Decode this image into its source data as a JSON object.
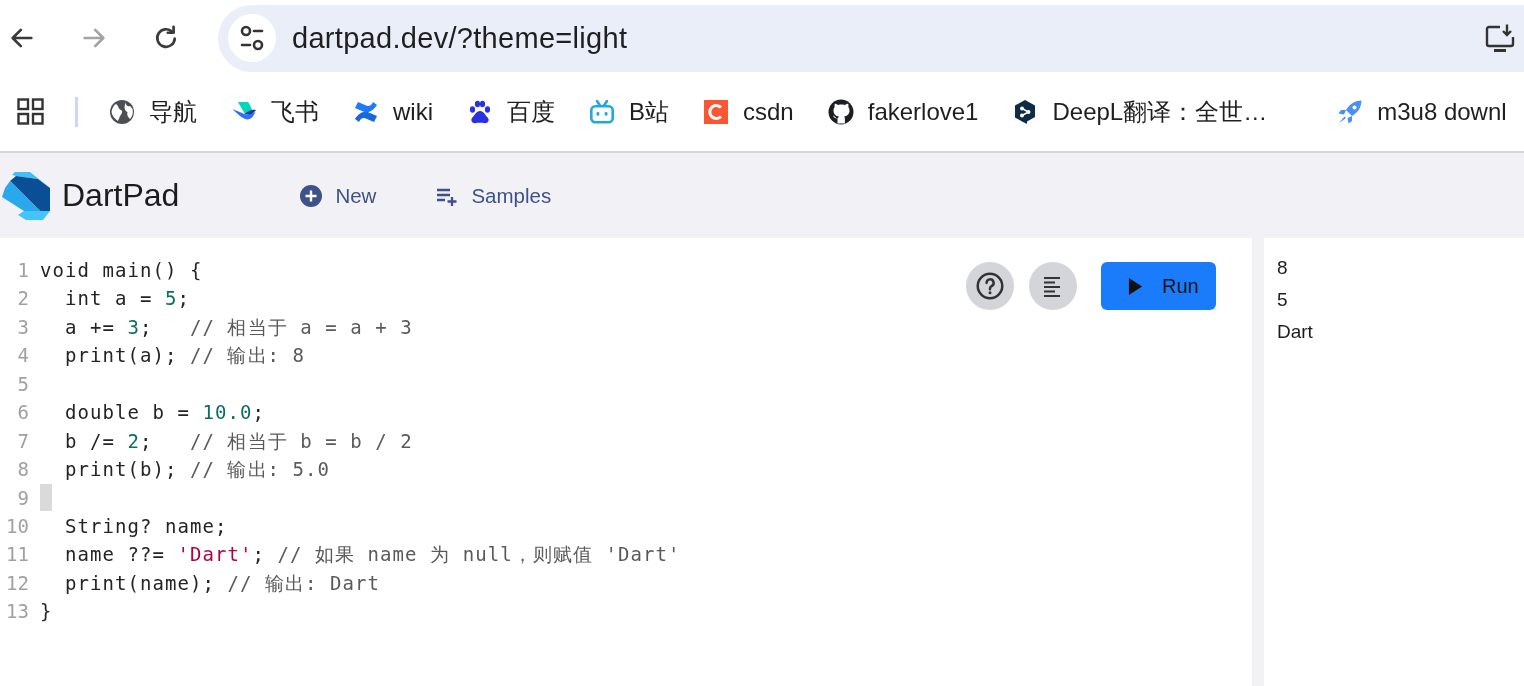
{
  "browser": {
    "nav": [
      {
        "kind": "back",
        "disabled": false
      },
      {
        "kind": "forward",
        "disabled": true
      },
      {
        "kind": "reload",
        "disabled": false
      }
    ],
    "address": "dartpad.dev/?theme=light"
  },
  "bookmarks": [
    {
      "kind": "globe",
      "label": "导航"
    },
    {
      "kind": "bird",
      "label": "飞书"
    },
    {
      "kind": "swoosh",
      "label": "wiki"
    },
    {
      "kind": "paw",
      "label": "百度"
    },
    {
      "kind": "tv",
      "label": "B站"
    },
    {
      "kind": "tile",
      "label": "csdn"
    },
    {
      "kind": "cat",
      "label": "fakerlove1"
    },
    {
      "kind": "hexagon",
      "label": "DeepL翻译：全世…"
    },
    {
      "kind": "rocket",
      "label": "m3u8 downl"
    }
  ],
  "app": {
    "title": "DartPad",
    "actions": [
      {
        "kind": "new",
        "label": "New"
      },
      {
        "kind": "samples",
        "label": "Samples"
      }
    ]
  },
  "editor": {
    "run_button": "Run",
    "lines": [
      {
        "number": "1",
        "cursor": false,
        "tokens": [
          {
            "kind": "plain",
            "text": "void main() {"
          }
        ]
      },
      {
        "number": "2",
        "cursor": false,
        "tokens": [
          {
            "kind": "plain",
            "text": "  int a = "
          },
          {
            "kind": "number",
            "text": "5"
          },
          {
            "kind": "plain",
            "text": ";"
          }
        ]
      },
      {
        "number": "3",
        "cursor": false,
        "tokens": [
          {
            "kind": "plain",
            "text": "  a += "
          },
          {
            "kind": "number",
            "text": "3"
          },
          {
            "kind": "plain",
            "text": ";   "
          },
          {
            "kind": "comment",
            "text": "// 相当于 a = a + 3"
          }
        ]
      },
      {
        "number": "4",
        "cursor": false,
        "tokens": [
          {
            "kind": "plain",
            "text": "  print(a); "
          },
          {
            "kind": "comment",
            "text": "// 输出: 8"
          }
        ]
      },
      {
        "number": "5",
        "cursor": false
      },
      {
        "number": "6",
        "cursor": false,
        "tokens": [
          {
            "kind": "plain",
            "text": "  double b = "
          },
          {
            "kind": "number",
            "text": "10.0"
          },
          {
            "kind": "plain",
            "text": ";"
          }
        ]
      },
      {
        "number": "7",
        "cursor": false,
        "tokens": [
          {
            "kind": "plain",
            "text": "  b /= "
          },
          {
            "kind": "number",
            "text": "2"
          },
          {
            "kind": "plain",
            "text": ";   "
          },
          {
            "kind": "comment",
            "text": "// 相当于 b = b / 2"
          }
        ]
      },
      {
        "number": "8",
        "cursor": false,
        "tokens": [
          {
            "kind": "plain",
            "text": "  print(b); "
          },
          {
            "kind": "comment",
            "text": "// 输出: 5.0"
          }
        ]
      },
      {
        "number": "9",
        "cursor": true
      },
      {
        "number": "10",
        "cursor": false,
        "tokens": [
          {
            "kind": "plain",
            "text": "  String? name;"
          }
        ]
      },
      {
        "number": "11",
        "cursor": false,
        "tokens": [
          {
            "kind": "plain",
            "text": "  name ??= "
          },
          {
            "kind": "string",
            "text": "'Dart'"
          },
          {
            "kind": "plain",
            "text": "; "
          },
          {
            "kind": "comment",
            "text": "// 如果 name 为 null，则赋值 'Dart'"
          }
        ]
      },
      {
        "number": "12",
        "cursor": false,
        "tokens": [
          {
            "kind": "plain",
            "text": "  print(name); "
          },
          {
            "kind": "comment",
            "text": "// 输出: Dart"
          }
        ]
      },
      {
        "number": "13",
        "cursor": false,
        "tokens": [
          {
            "kind": "plain",
            "text": "}"
          }
        ]
      }
    ]
  },
  "output": {
    "lines": [
      "8",
      "5",
      "Dart"
    ]
  }
}
